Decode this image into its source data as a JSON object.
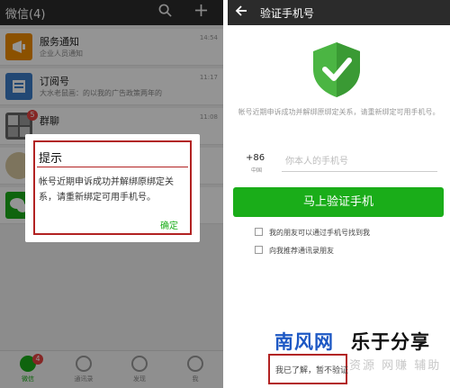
{
  "left_screen": {
    "title": "微信(4)",
    "chats": [
      {
        "name": "服务通知",
        "sub": "企业人员通知",
        "time": "14:54",
        "color": "#f08c00",
        "icon": "megaphone-icon"
      },
      {
        "name": "订阅号",
        "sub": "大水老鼠画：的以我的广告政策两年的",
        "time": "11:17",
        "color": "#3b7cc8",
        "icon": "subscription-icon"
      },
      {
        "name": "群聊",
        "sub": "",
        "time": "11:08",
        "color": "#666666",
        "icon": "group-icon",
        "badge": "5"
      },
      {
        "name": "",
        "sub": "",
        "time": "",
        "color": "#d8c9a0",
        "icon": "avatar-icon"
      },
      {
        "name": "",
        "sub": "",
        "time": "",
        "color": "#1aad19",
        "icon": "wechat-icon"
      }
    ],
    "tabs": [
      {
        "label": "微信",
        "badge": "4"
      },
      {
        "label": "通讯录"
      },
      {
        "label": "发现"
      },
      {
        "label": "我"
      }
    ],
    "dialog": {
      "title": "提示",
      "body": "帐号近期申诉成功并解绑原绑定关系，请重新绑定可用手机号。",
      "button": "确定"
    }
  },
  "right_screen": {
    "title": "验证手机号",
    "description": "帐号近期申诉成功并解绑原绑定关系，请重新绑定可用手机号。",
    "country_code": "+86",
    "country_name": "中国",
    "phone_placeholder": "你本人的手机号",
    "verify_button": "马上验证手机",
    "option1": "我的朋友可以通过手机号找到我",
    "option2": "向我推荐通讯录朋友",
    "later_link": "我已了解，暂不验证",
    "accent": "#1aad19"
  },
  "watermark": {
    "part1": "南风网",
    "part2": "乐于分享",
    "part3": "资源 网赚 辅助"
  }
}
